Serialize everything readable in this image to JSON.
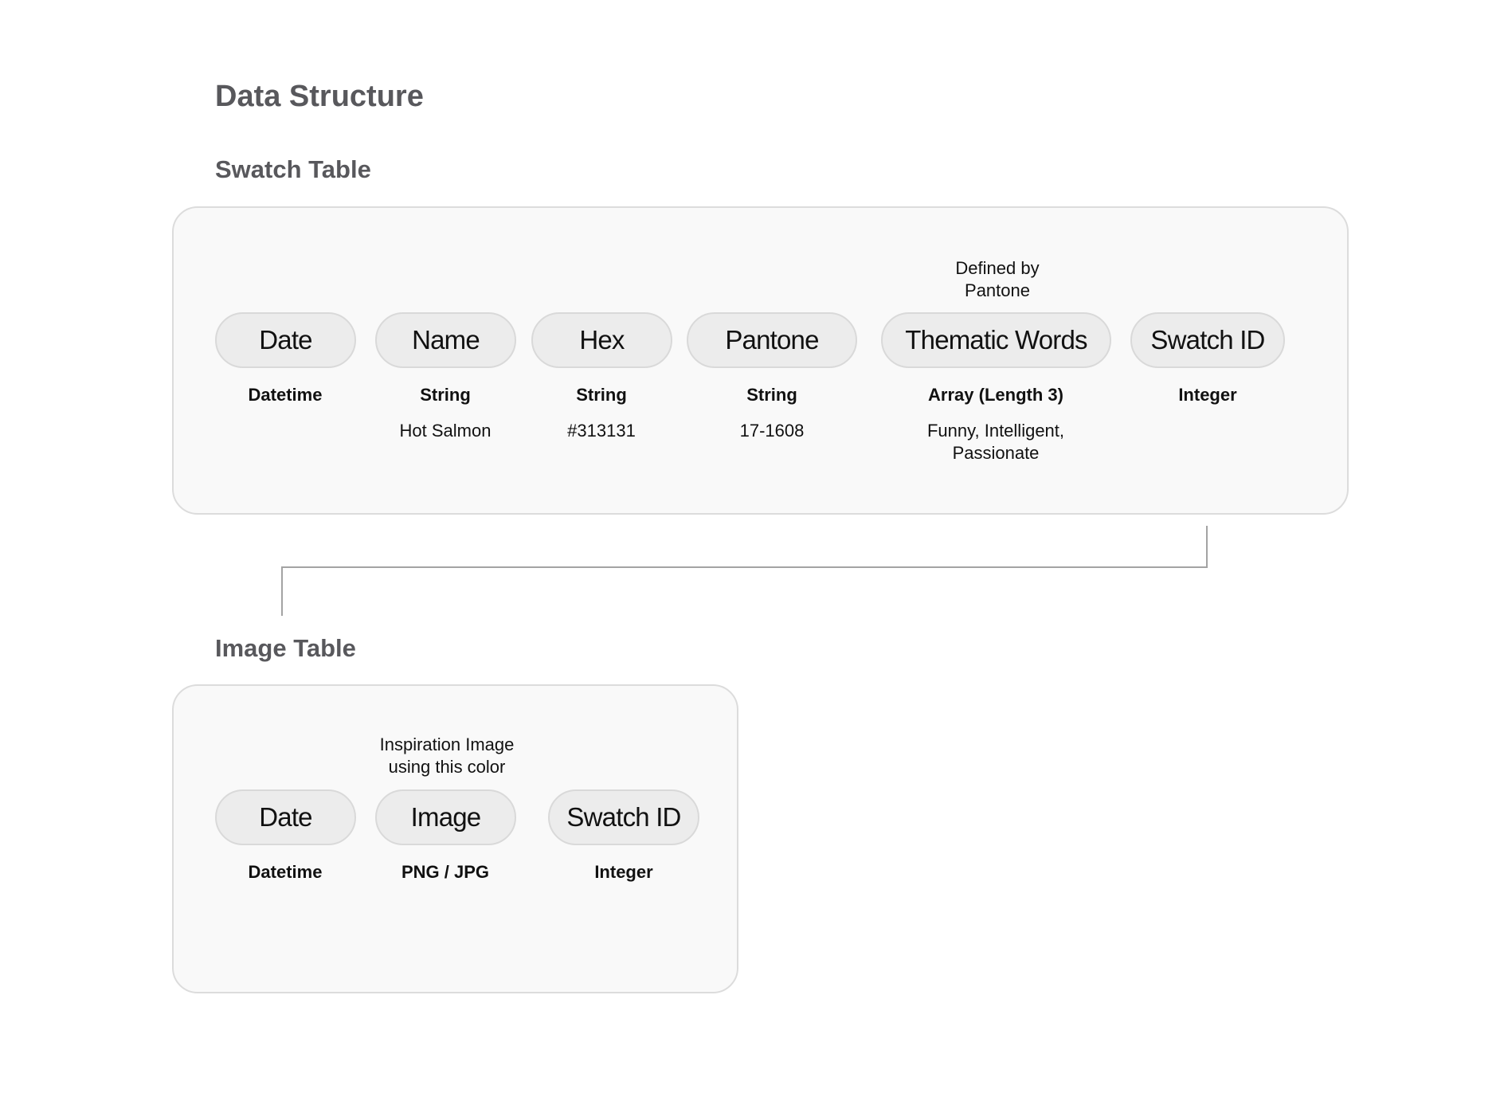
{
  "title": "Data Structure",
  "swatch_table": {
    "heading": "Swatch Table",
    "columns": [
      {
        "field": "Date",
        "type": "Datetime",
        "example": "",
        "note": ""
      },
      {
        "field": "Name",
        "type": "String",
        "example": "Hot Salmon",
        "note": ""
      },
      {
        "field": "Hex",
        "type": "String",
        "example": "#313131",
        "note": ""
      },
      {
        "field": "Pantone",
        "type": "String",
        "example": "17-1608",
        "note": ""
      },
      {
        "field": "Thematic Words",
        "type": "Array (Length 3)",
        "example": "Funny, Intelligent, Passionate",
        "note": "Defined by Pantone"
      },
      {
        "field": "Swatch ID",
        "type": "Integer",
        "example": "",
        "note": ""
      }
    ]
  },
  "image_table": {
    "heading": "Image Table",
    "columns": [
      {
        "field": "Date",
        "type": "Datetime",
        "note": ""
      },
      {
        "field": "Image",
        "type": "PNG / JPG",
        "note": "Inspiration Image using this color"
      },
      {
        "field": "Swatch ID",
        "type": "Integer",
        "note": ""
      }
    ]
  },
  "relationship": {
    "from": "Swatch Table.Swatch ID",
    "to": "Image Table"
  },
  "colors": {
    "heading": "#58585c",
    "box_bg": "#f9f9f9",
    "box_border": "#dcdcdc",
    "pill_bg": "#ececec",
    "pill_border": "#d9d9d9",
    "connector": "#a3a3a3"
  }
}
